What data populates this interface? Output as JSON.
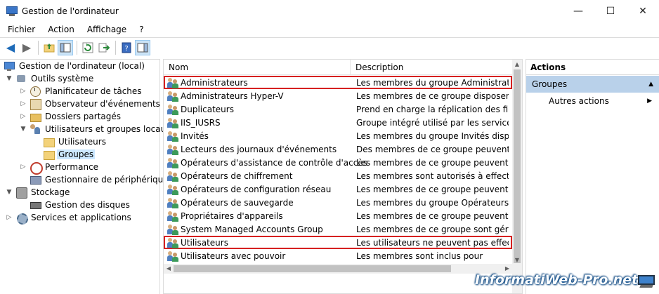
{
  "window": {
    "title": "Gestion de l'ordinateur",
    "minimize": "—",
    "maximize": "☐",
    "close": "✕"
  },
  "menu": [
    "Fichier",
    "Action",
    "Affichage",
    "?"
  ],
  "tree": {
    "root": "Gestion de l'ordinateur (local)",
    "items": [
      {
        "label": "Outils système"
      },
      {
        "label": "Planificateur de tâches"
      },
      {
        "label": "Observateur d'événements"
      },
      {
        "label": "Dossiers partagés"
      },
      {
        "label": "Utilisateurs et groupes locaux"
      },
      {
        "label": "Utilisateurs"
      },
      {
        "label": "Groupes"
      },
      {
        "label": "Performance"
      },
      {
        "label": "Gestionnaire de périphériques"
      },
      {
        "label": "Stockage"
      },
      {
        "label": "Gestion des disques"
      },
      {
        "label": "Services et applications"
      }
    ],
    "selected": "Groupes"
  },
  "list": {
    "columns": {
      "name": "Nom",
      "description": "Description"
    },
    "rows": [
      {
        "name": "Administrateurs",
        "description": "Les membres du groupe Administrateurs",
        "highlighted": true
      },
      {
        "name": "Administrateurs Hyper-V",
        "description": "Les membres de ce groupe disposent d'un"
      },
      {
        "name": "Duplicateurs",
        "description": "Prend en charge la réplication des fichiers"
      },
      {
        "name": "IIS_IUSRS",
        "description": "Groupe intégré utilisé par les services Inter"
      },
      {
        "name": "Invités",
        "description": "Les membres du groupe Invités disposent"
      },
      {
        "name": "Lecteurs des journaux d'événements",
        "description": "Des membres de ce groupe peuvent lire le"
      },
      {
        "name": "Opérateurs d'assistance de contrôle d'accès",
        "description": "Les membres de ce groupe peuvent interr"
      },
      {
        "name": "Opérateurs de chiffrement",
        "description": "Les membres sont autorisés à effectuer de"
      },
      {
        "name": "Opérateurs de configuration réseau",
        "description": "Les membres de ce groupe peuvent dispo"
      },
      {
        "name": "Opérateurs de sauvegarde",
        "description": "Les membres du groupe Opérateurs de sa"
      },
      {
        "name": "Propriétaires d'appareils",
        "description": "Les membres de ce groupe peuvent modi"
      },
      {
        "name": "System Managed Accounts Group",
        "description": "Les membres de ce groupe sont gérés par"
      },
      {
        "name": "Utilisateurs",
        "description": "Les utilisateurs ne peuvent pas effectuer d",
        "highlighted": true
      },
      {
        "name": "Utilisateurs avec pouvoir",
        "description": "Les membres sont inclus pour"
      }
    ]
  },
  "actions": {
    "header": "Actions",
    "group": "Groupes",
    "item": "Autres actions"
  },
  "watermark": "InformatiWeb-Pro.net",
  "colors": {
    "selection": "#cce8ff",
    "highlight_border": "#d62020",
    "action_group_bg": "#b9d1ea"
  }
}
